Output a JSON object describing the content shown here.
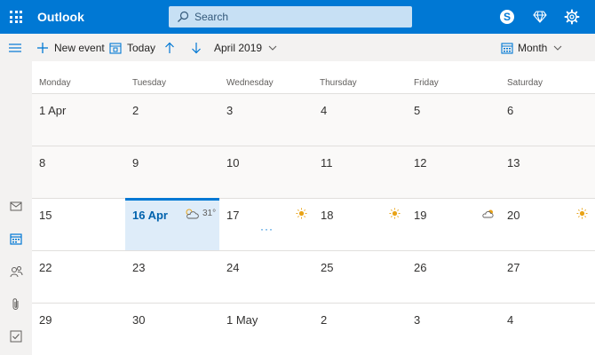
{
  "app": {
    "title": "Outlook"
  },
  "search": {
    "placeholder": "Search"
  },
  "toolbar": {
    "new_event": "New event",
    "today": "Today",
    "period": "April 2019",
    "view": "Month"
  },
  "calendar": {
    "weekdays": [
      "Monday",
      "Tuesday",
      "Wednesday",
      "Thursday",
      "Friday",
      "Saturday"
    ],
    "weeks": [
      [
        "1 Apr",
        "2",
        "3",
        "4",
        "5",
        "6"
      ],
      [
        "8",
        "9",
        "10",
        "11",
        "12",
        "13"
      ],
      [
        "15",
        "16 Apr",
        "17",
        "18",
        "19",
        "20"
      ],
      [
        "22",
        "23",
        "24",
        "25",
        "26",
        "27"
      ],
      [
        "29",
        "30",
        "1 May",
        "2",
        "3",
        "4"
      ]
    ],
    "today_weather": {
      "temperature": "31°",
      "icon": "partly-cloudy-icon"
    },
    "more_indicator": "···",
    "weather_icons": {
      "17": "sunny-icon",
      "18": "sunny-icon",
      "19": "cloudy-sun-icon",
      "20": "sunny-icon"
    }
  },
  "colors": {
    "brand_blue": "#0078d4",
    "today_bg": "#deecf9",
    "search_bg": "#c7e0f4",
    "sun": "#e8a317"
  }
}
